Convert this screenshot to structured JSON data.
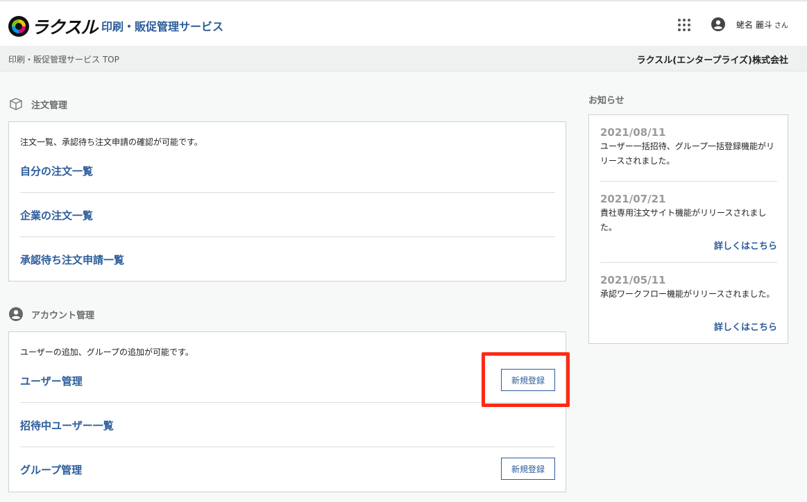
{
  "header": {
    "logo_text": "ラクスル",
    "service_name": "印刷・販促管理サービス",
    "user_name": "蛯名 麗斗",
    "user_suffix": "さん"
  },
  "subbar": {
    "breadcrumb": "印刷・販促管理サービス TOP",
    "company": "ラクスル(エンタープライズ)株式会社"
  },
  "order_section": {
    "title": "注文管理",
    "description": "注文一覧、承認待ち注文申請の確認が可能です。",
    "links": [
      {
        "label": "自分の注文一覧"
      },
      {
        "label": "企業の注文一覧"
      },
      {
        "label": "承認待ち注文申請一覧"
      }
    ]
  },
  "account_section": {
    "title": "アカウント管理",
    "description": "ユーザーの追加、グループの追加が可能です。",
    "links": [
      {
        "label": "ユーザー管理",
        "button": "新規登録"
      },
      {
        "label": "招待中ユーザー一覧"
      },
      {
        "label": "グループ管理",
        "button": "新規登録"
      }
    ]
  },
  "news": {
    "title": "お知らせ",
    "items": [
      {
        "date": "2021/08/11",
        "text": "ユーザー一括招待、グループ一括登録機能がリリースされました。"
      },
      {
        "date": "2021/07/21",
        "text": "貴社専用注文サイト機能がリリースされました。",
        "more": "詳しくはこちら"
      },
      {
        "date": "2021/05/11",
        "text": "承認ワークフロー機能がリリースされました。",
        "more": "詳しくはこちら"
      }
    ]
  },
  "colors": {
    "accent": "#2b5c9a",
    "highlight": "#ff2a14"
  },
  "icons": {
    "apps": "grid-dots-icon",
    "user": "user-circle-icon",
    "order": "box-icon",
    "account": "user-circle-icon"
  }
}
